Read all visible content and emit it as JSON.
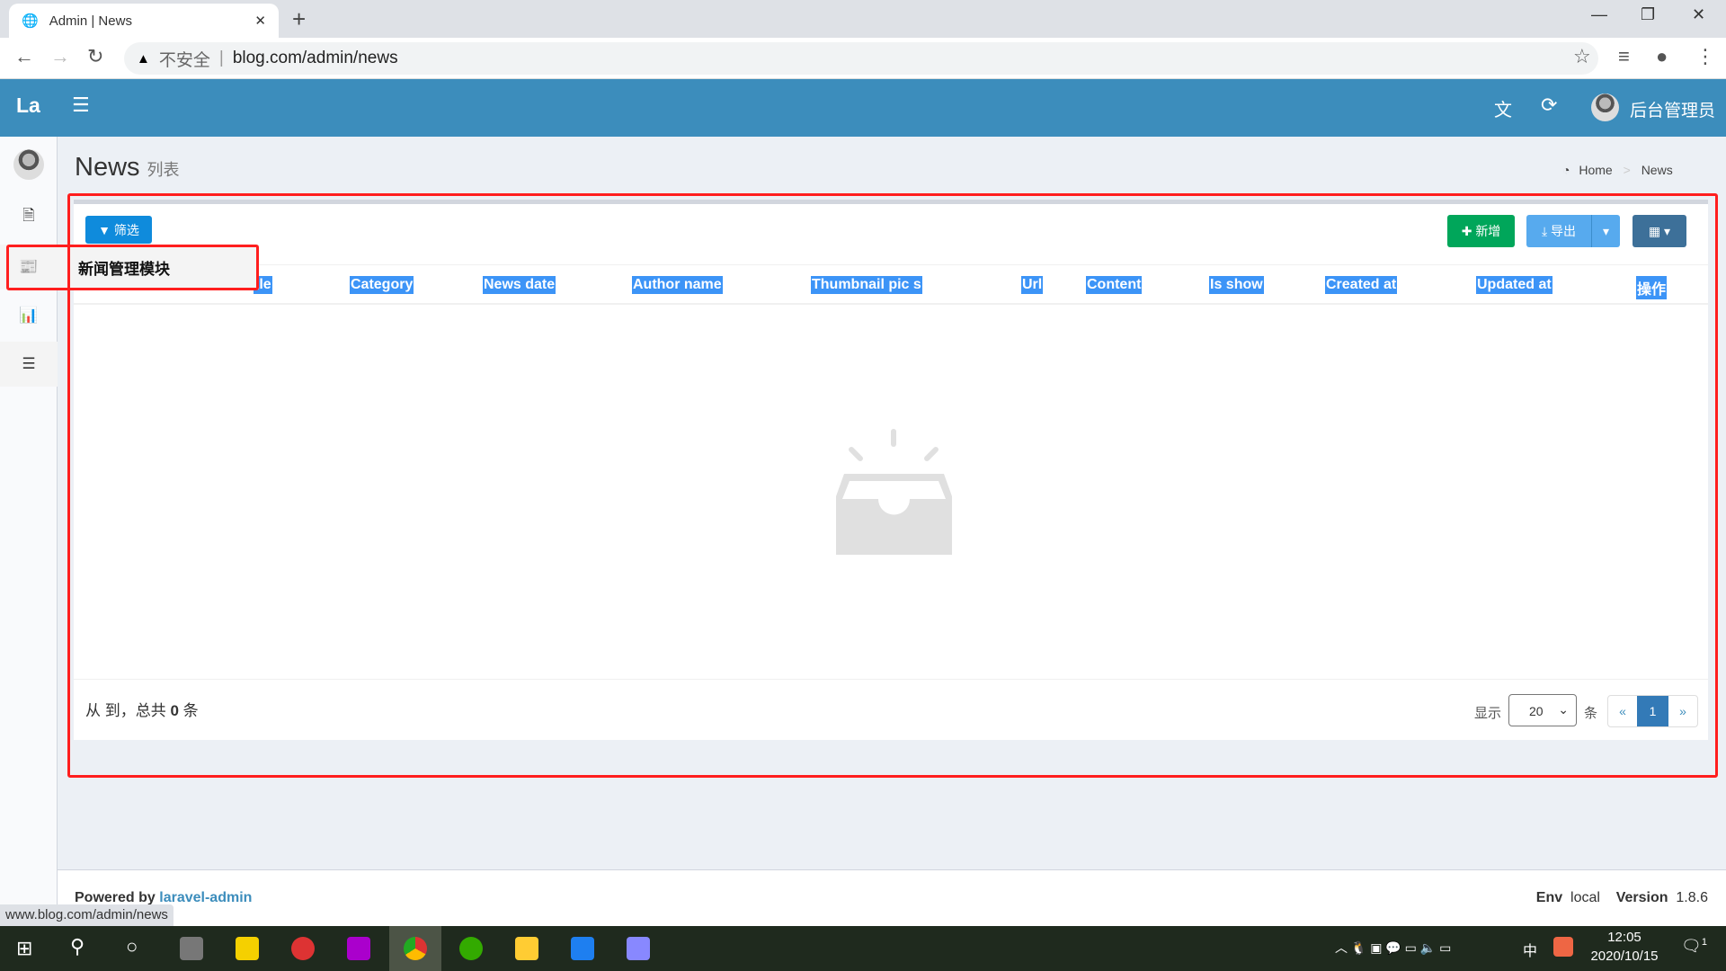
{
  "browser": {
    "tab_title": "Admin | News",
    "security": "不安全",
    "url": "blog.com/admin/news",
    "status_url": "www.blog.com/admin/news"
  },
  "header": {
    "logo": "La",
    "user": "后台管理员",
    "icons": [
      "translate-icon",
      "refresh-icon"
    ]
  },
  "page": {
    "title": "News",
    "subtitle": "列表",
    "breadcrumb": [
      "Home",
      "News"
    ]
  },
  "toolbar": {
    "filter": "筛选",
    "new": "新增",
    "export": "导出"
  },
  "table": {
    "columns": [
      "tle",
      "Category",
      "News date",
      "Author name",
      "Thumbnail pic s",
      "Url",
      "Content",
      "Is show",
      "Created at",
      "Updated at",
      "操作"
    ],
    "rows": []
  },
  "sidebar": {
    "popup_label": "新闻管理模块"
  },
  "pagination": {
    "summary_prefix": "从 到，总共",
    "total": "0",
    "summary_suffix": "条",
    "show_label": "显示",
    "per_page": "20",
    "per_page_suffix": "条",
    "prev": "«",
    "current": "1",
    "next": "»"
  },
  "footer": {
    "powered": "Powered by",
    "link": "laravel-admin",
    "env_label": "Env",
    "env": "local",
    "version_label": "Version",
    "version": "1.8.6"
  },
  "taskbar": {
    "time": "12:05",
    "date": "2020/10/15",
    "ime": "中",
    "notifications": "1"
  },
  "colors": {
    "header": "#3c8dbc",
    "new_button": "#00a65a",
    "filter_button": "#0f8bdc",
    "highlight": "#3c94f7",
    "annotation": "#ff1e1e"
  }
}
